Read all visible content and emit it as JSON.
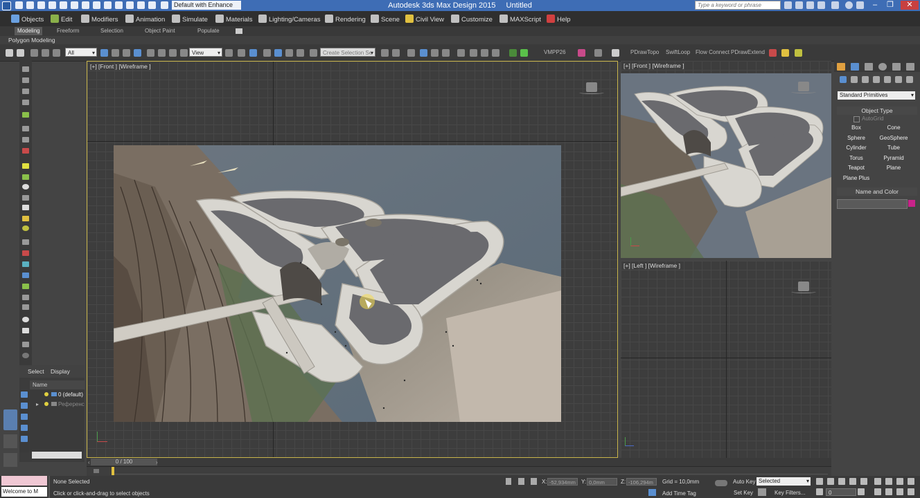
{
  "titlebar": {
    "workspace": "Default with Enhance",
    "app_title": "Autodesk 3ds Max Design 2015",
    "document_title": "Untitled",
    "search_placeholder": "Type a keyword or phrase"
  },
  "menu": [
    {
      "label": "Objects",
      "color": "#6aa0e0"
    },
    {
      "label": "Edit",
      "color": "#8ab04a"
    },
    {
      "label": "Modifiers",
      "color": "#c0c0c0"
    },
    {
      "label": "Animation",
      "color": "#c0c0c0"
    },
    {
      "label": "Simulate",
      "color": "#c0c0c0"
    },
    {
      "label": "Materials",
      "color": "#c0c0c0"
    },
    {
      "label": "Lighting/Cameras",
      "color": "#c0c0c0"
    },
    {
      "label": "Rendering",
      "color": "#c0c0c0"
    },
    {
      "label": "Scene",
      "color": "#c0c0c0"
    },
    {
      "label": "Civil View",
      "color": "#e0c040"
    },
    {
      "label": "Customize",
      "color": "#c0c0c0"
    },
    {
      "label": "MAXScript",
      "color": "#c0c0c0"
    },
    {
      "label": "Help",
      "color": "#d04040"
    }
  ],
  "ribbon": {
    "tabs": [
      "Modeling",
      "Freeform",
      "Selection",
      "Object Paint",
      "Populate"
    ],
    "active": "Modeling",
    "panel": "Polygon Modeling"
  },
  "toolbar": {
    "filter": "All",
    "ref_coord": "View",
    "selection_set": "Create Selection Se",
    "plugins": [
      "VMPP26",
      "PDrawTopo",
      "SwiftLoop",
      "Flow Connect",
      "PDrawExtend"
    ]
  },
  "scene_explorer": {
    "tabs": [
      "Select",
      "Display"
    ],
    "column": "Name",
    "rows": [
      "0 (default)",
      "Референс"
    ]
  },
  "viewports": {
    "front": "[+] [Front ] [Wireframe ]",
    "top_right": "[+] [Front ] [Wireframe ]",
    "left": "[+] [Left ] [Wireframe ]"
  },
  "command_panel": {
    "dropdown": "Standard Primitives",
    "object_type_title": "Object Type",
    "autogrid": "AutoGrid",
    "primitives": [
      "Box",
      "Cone",
      "Sphere",
      "GeoSphere",
      "Cylinder",
      "Tube",
      "Torus",
      "Pyramid",
      "Teapot",
      "Plane",
      "Plane Plus"
    ],
    "name_color_title": "Name and Color",
    "color": "#c8238a"
  },
  "timeline": {
    "frame": "0 / 100"
  },
  "status": {
    "maxscript_top": "",
    "maxscript_bottom": "Welcome to M",
    "selected": "None Selected",
    "prompt": "Click or click-and-drag to select objects",
    "x_label": "X:",
    "x_value": "-52,934mm",
    "y_label": "Y:",
    "y_value": "0,0mm",
    "z_label": "Z:",
    "z_value": "-106,294m",
    "grid": "Grid = 10,0mm",
    "auto_key": "Auto Key",
    "set_key": "Set Key",
    "key_mode": "Selected",
    "key_filters": "Key Filters...",
    "add_time_tag": "Add Time Tag",
    "frame_value": "0"
  }
}
